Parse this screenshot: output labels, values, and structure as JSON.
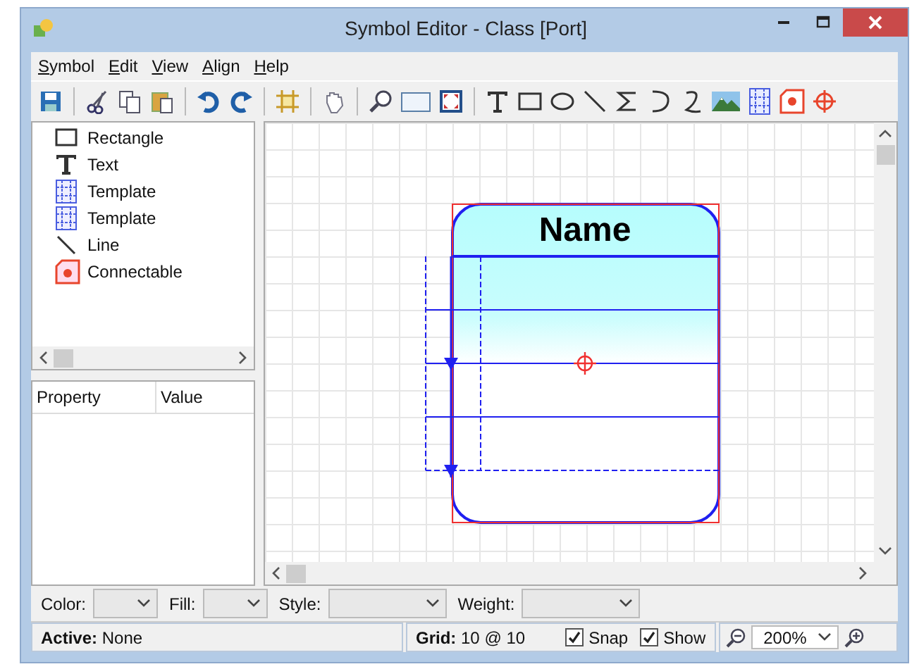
{
  "window": {
    "title": "Symbol Editor - Class [Port]"
  },
  "menu": [
    {
      "label": "Symbol"
    },
    {
      "label": "Edit"
    },
    {
      "label": "View"
    },
    {
      "label": "Align"
    },
    {
      "label": "Help"
    }
  ],
  "tree": {
    "items": [
      {
        "kind": "rectangle",
        "label": "Rectangle"
      },
      {
        "kind": "text",
        "label": "Text"
      },
      {
        "kind": "template",
        "label": "Template"
      },
      {
        "kind": "template",
        "label": "Template"
      },
      {
        "kind": "line",
        "label": "Line"
      },
      {
        "kind": "connectable",
        "label": "Connectable"
      }
    ]
  },
  "properties": {
    "columns": [
      "Property",
      "Value"
    ]
  },
  "canvas": {
    "symbol": {
      "title": "Name"
    }
  },
  "format_bar": [
    {
      "label": "Color:",
      "kind": "small"
    },
    {
      "label": "Fill:",
      "kind": "small"
    },
    {
      "label": "Style:",
      "kind": "wide"
    },
    {
      "label": "Weight:",
      "kind": "wide"
    }
  ],
  "status_bar": {
    "active_label": "Active:",
    "active_value": "None",
    "grid_label": "Grid:",
    "grid_value": "10 @ 10",
    "toggles": [
      {
        "label": "Snap",
        "checked": true
      },
      {
        "label": "Show",
        "checked": true
      }
    ],
    "zoom": "200%"
  }
}
